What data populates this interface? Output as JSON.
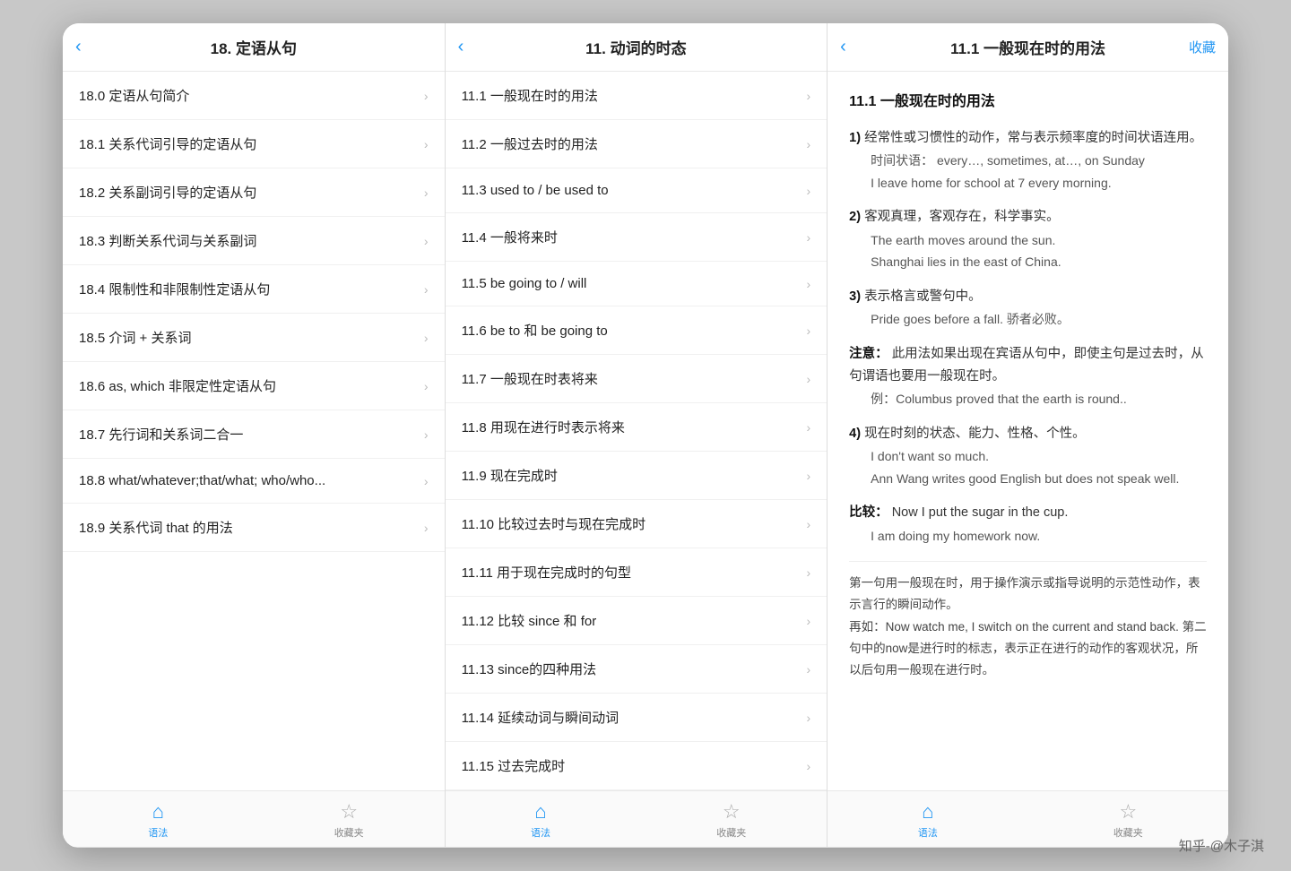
{
  "panels": [
    {
      "id": "panel-left",
      "header": {
        "back": "‹",
        "title": "18. 定语从句",
        "collect": null
      },
      "items": [
        {
          "text": "18.0 定语从句简介"
        },
        {
          "text": "18.1 关系代词引导的定语从句"
        },
        {
          "text": "18.2 关系副词引导的定语从句"
        },
        {
          "text": "18.3 判断关系代词与关系副词"
        },
        {
          "text": "18.4 限制性和非限制性定语从句"
        },
        {
          "text": "18.5 介词 + 关系词"
        },
        {
          "text": "18.6 as, which 非限定性定语从句"
        },
        {
          "text": "18.7 先行词和关系词二合一"
        },
        {
          "text": "18.8 what/whatever;that/what; who/who..."
        },
        {
          "text": "18.9 关系代词 that 的用法"
        }
      ],
      "tabs": [
        {
          "icon": "⌂",
          "label": "语法",
          "active": true
        },
        {
          "icon": "☆",
          "label": "收藏夹",
          "active": false
        }
      ]
    },
    {
      "id": "panel-middle",
      "header": {
        "back": "‹",
        "title": "11. 动词的时态",
        "collect": null
      },
      "items": [
        {
          "text": "11.1 一般现在时的用法"
        },
        {
          "text": "11.2 一般过去时的用法"
        },
        {
          "text": "11.3 used to / be used to"
        },
        {
          "text": "11.4 一般将来时"
        },
        {
          "text": "11.5 be going to / will"
        },
        {
          "text": "11.6 be to 和 be going to"
        },
        {
          "text": "11.7 一般现在时表将来"
        },
        {
          "text": "11.8 用现在进行时表示将来"
        },
        {
          "text": "11.9 现在完成时"
        },
        {
          "text": "11.10 比较过去时与现在完成时"
        },
        {
          "text": "11.11 用于现在完成时的句型"
        },
        {
          "text": "11.12 比较 since 和 for"
        },
        {
          "text": "11.13 since的四种用法"
        },
        {
          "text": "11.14 延续动词与瞬间动词"
        },
        {
          "text": "11.15 过去完成时"
        }
      ],
      "tabs": [
        {
          "icon": "⌂",
          "label": "语法",
          "active": true
        },
        {
          "icon": "☆",
          "label": "收藏夹",
          "active": false
        }
      ]
    },
    {
      "id": "panel-right",
      "header": {
        "back": "‹",
        "title": "11.1 一般现在时的用法",
        "collect": "收藏"
      },
      "content": {
        "title": "11.1 一般现在时的用法",
        "sections": [
          {
            "num": "1)",
            "main": "经常性或习惯性的动作，常与表示频率度的时间状语连用。",
            "sub": "时间状语：  every…, sometimes,  at…, on Sunday",
            "examples": [
              "I leave home for school at 7 every morning."
            ]
          },
          {
            "num": "2)",
            "main": "客观真理，客观存在，科学事实。",
            "sub": "",
            "examples": [
              "The earth moves around the sun.",
              "Shanghai lies in the east of China."
            ]
          },
          {
            "num": "3)",
            "main": "表示格言或警句中。",
            "sub": "",
            "examples": [
              "Pride goes before a fall.  骄者必败。"
            ]
          },
          {
            "num": "注意：",
            "main": "此用法如果出现在宾语从句中，即使主句是过去时，从句谓语也要用一般现在时。",
            "sub": "例：Columbus proved that the earth is round..",
            "examples": []
          },
          {
            "num": "4)",
            "main": "现在时刻的状态、能力、性格、个性。",
            "sub": "",
            "examples": [
              "I don't want so much.",
              "Ann Wang writes good English but does not speak well."
            ]
          },
          {
            "num": "比较：",
            "main": "Now I put the sugar in the cup.",
            "sub": "I am doing my homework now.",
            "examples": []
          }
        ],
        "note": "第一句用一般现在时，用于操作演示或指导说明的示范性动作，表示言行的瞬间动作。\n再如：Now watch me, I switch on the current and stand back. 第二句中的now是进行时的标志，表示正在进行的动作的客观状况，所以后句用一般现在进行时。"
      },
      "tabs": [
        {
          "icon": "⌂",
          "label": "语法",
          "active": true
        },
        {
          "icon": "☆",
          "label": "收藏夹",
          "active": false
        }
      ]
    }
  ],
  "watermark": "知乎-@木子淇",
  "colors": {
    "accent": "#2196F3",
    "text_primary": "#222",
    "text_secondary": "#555",
    "border": "#e8e8e8",
    "chevron": "#bbb"
  }
}
